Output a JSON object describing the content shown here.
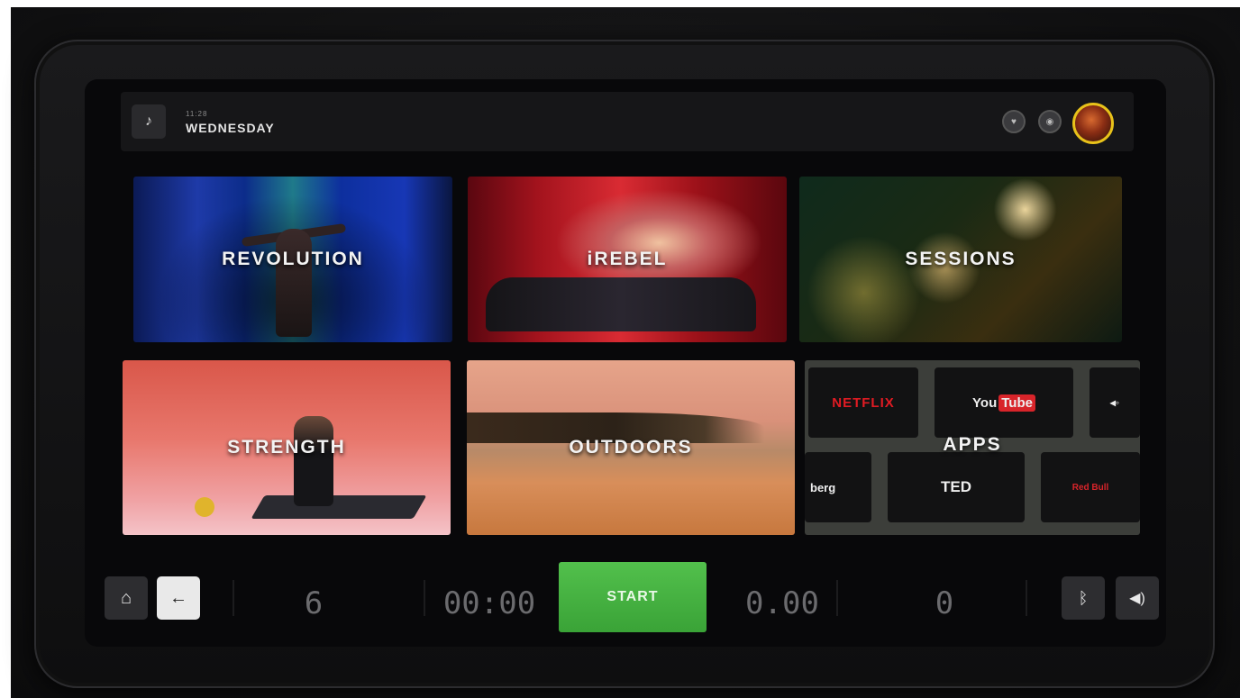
{
  "header": {
    "time": "11:28",
    "day": "WEDNESDAY",
    "music_icon": "music-note-icon",
    "left_round_icon": "heart-rate-icon",
    "right_round_icon": "wifi-icon"
  },
  "tiles": [
    {
      "label": "REVOLUTION"
    },
    {
      "label": "iREBEL"
    },
    {
      "label": "SESSIONS"
    },
    {
      "label": "STRENGTH"
    },
    {
      "label": "OUTDOORS"
    },
    {
      "label": "APPS"
    }
  ],
  "apps": {
    "netflix": "NETFLIX",
    "youtube_you": "You",
    "youtube_tube": "Tube",
    "bloomberg": "berg",
    "ted": "TED",
    "redbull": "Red Bull"
  },
  "bottom_bar": {
    "level_value": "6",
    "time_value": "00:00",
    "start_label": "START",
    "distance_value": "0.00",
    "rpm_value": "0"
  },
  "colors": {
    "start_green": "#46b142",
    "avatar_ring": "#e8c21a",
    "bar_background": "#161618"
  }
}
